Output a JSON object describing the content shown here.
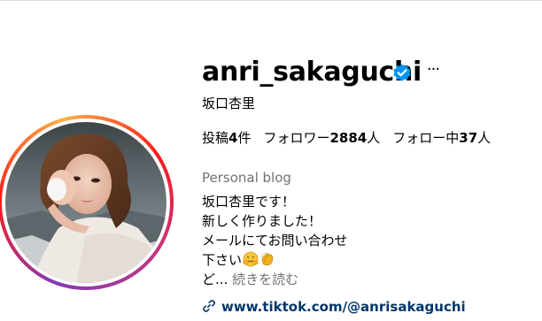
{
  "profile": {
    "username": "anri_sakaguchi",
    "verified": true,
    "verified_icon": "verified-badge-icon",
    "more_icon": "more-options-icon",
    "more_label": "···",
    "full_name": "坂口杏里",
    "avatar": "profile-photo",
    "ring_colors": [
      "#833ab4",
      "#fd1d1d",
      "#fcb045"
    ]
  },
  "stats": {
    "posts_label": "投稿",
    "posts_count": "4",
    "posts_suffix": "件",
    "followers_label": "フォロワー",
    "followers_count": "2884",
    "followers_suffix": "人",
    "following_label": "フォロー中",
    "following_count": "37",
    "following_suffix": "人"
  },
  "bio": {
    "category": "Personal blog",
    "lines": [
      "坂口杏里です！",
      "新しく作りました！",
      "メールにてお問い合わせ",
      "下さい"
    ],
    "emojis": [
      "hugging-face-icon",
      "clapping-hands-icon"
    ],
    "truncated_text": "ど...",
    "more_label": "続きを読む"
  },
  "link": {
    "icon": "link-icon",
    "text": "www.tiktok.com/@anrisakaguchi"
  },
  "colors": {
    "verified": "#0095f6",
    "link": "#00376b",
    "secondary_text": "#737373"
  }
}
